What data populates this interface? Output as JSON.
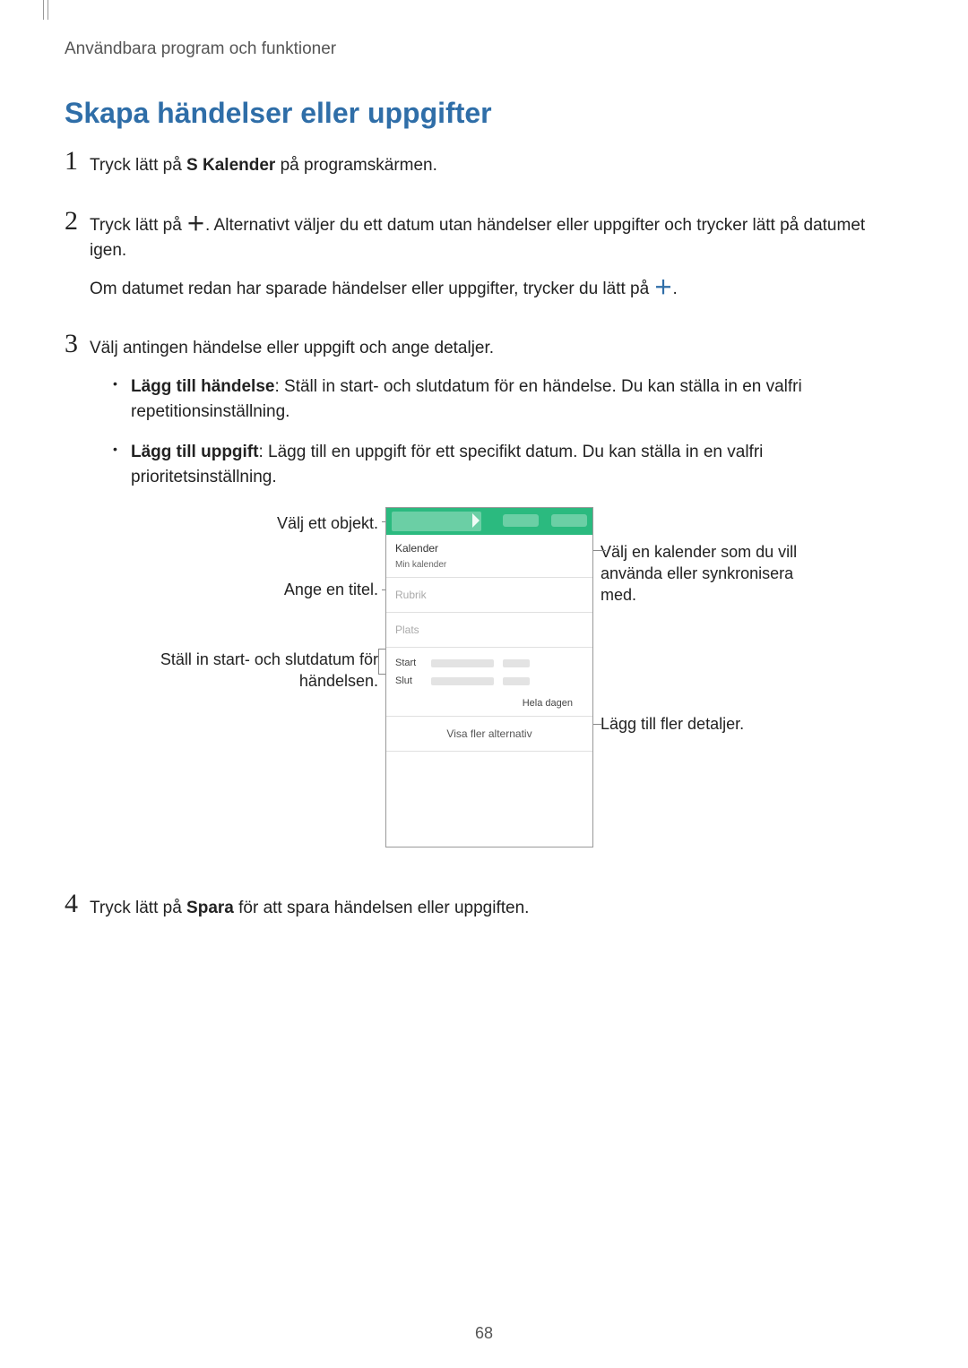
{
  "header": "Användbara program och funktioner",
  "section_title": "Skapa händelser eller uppgifter",
  "steps": {
    "s1_pre": "Tryck lätt på ",
    "s1_bold": "S Kalender",
    "s1_post": " på programskärmen.",
    "s2a_pre": "Tryck lätt på ",
    "s2a_post": ". Alternativt väljer du ett datum utan händelser eller uppgifter och trycker lätt på datumet igen.",
    "s2b_pre": "Om datumet redan har sparade händelser eller uppgifter, trycker du lätt på ",
    "s2b_post": ".",
    "s3_intro": "Välj antingen händelse eller uppgift och ange detaljer.",
    "b1_bold": "Lägg till händelse",
    "b1_text": ": Ställ in start- och slutdatum för en händelse. Du kan ställa in en valfri repetitionsinställning.",
    "b2_bold": "Lägg till uppgift",
    "b2_text": ": Lägg till en uppgift för ett specifikt datum. Du kan ställa in en valfri prioritetsinställning.",
    "s4_pre": "Tryck lätt på ",
    "s4_bold": "Spara",
    "s4_post": " för att spara händelsen eller uppgiften."
  },
  "callouts": {
    "select_item": "Välj ett objekt.",
    "enter_title": "Ange en titel.",
    "set_dates": "Ställ in start- och slutdatum för händelsen.",
    "choose_cal": "Välj en kalender som du vill använda eller synkronisera med.",
    "add_more": "Lägg till fler detaljer."
  },
  "phone": {
    "calendar_label": "Kalender",
    "calendar_sub": "Min kalender",
    "title_placeholder": "Rubrik",
    "place_placeholder": "Plats",
    "start": "Start",
    "end": "Slut",
    "allday": "Hela dagen",
    "more": "Visa fler alternativ"
  },
  "numbers": {
    "n1": "1",
    "n2": "2",
    "n3": "3",
    "n4": "4"
  },
  "page_number": "68"
}
